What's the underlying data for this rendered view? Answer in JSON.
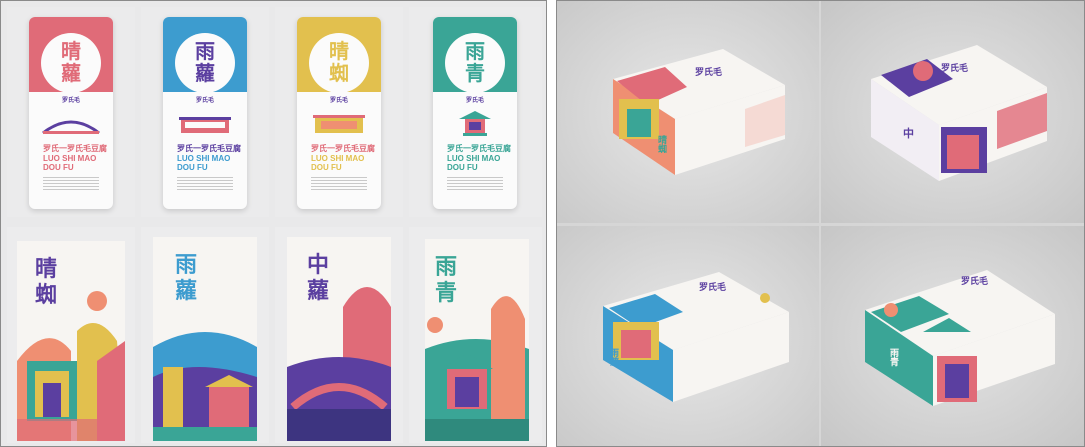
{
  "colors": {
    "pink": "#e06b78",
    "blue": "#3d9ccf",
    "yellow": "#e2c04e",
    "teal": "#3aa596",
    "purple": "#5b3fa0",
    "coral": "#ef8f72",
    "bg_left": "#e9e9ea",
    "bg_right": "#d6d6d6"
  },
  "pouches": [
    {
      "glyph_top": "晴",
      "glyph_bottom": "蘿",
      "brand": "罗氏毛",
      "cn_name": "罗氏一罗氏毛豆腐",
      "pinyin_1": "LUO SHI MAO",
      "pinyin_2": "DOU FU",
      "color": "#e06b78",
      "icon": "bridge-icon"
    },
    {
      "glyph_top": "雨",
      "glyph_bottom": "蘿",
      "brand": "罗氏毛",
      "cn_name": "罗氏一罗氏毛豆腐",
      "pinyin_1": "LUO SHI MAO",
      "pinyin_2": "DOU FU",
      "color": "#3d9ccf",
      "icon": "gate-icon"
    },
    {
      "glyph_top": "晴",
      "glyph_bottom": "蜘",
      "brand": "罗氏毛",
      "cn_name": "罗氏一罗氏毛豆腐",
      "pinyin_1": "LUO SHI MAO",
      "pinyin_2": "DOU FU",
      "color": "#e2c04e",
      "icon": "plaque-icon"
    },
    {
      "glyph_top": "雨",
      "glyph_bottom": "青",
      "brand": "罗氏毛",
      "cn_name": "罗氏一罗氏毛豆腐",
      "pinyin_1": "LUO SHI MAO",
      "pinyin_2": "DOU FU",
      "color": "#3aa596",
      "icon": "pavilion-icon"
    }
  ],
  "boxes_tall": [
    {
      "glyph_top": "晴",
      "glyph_bottom": "蜘"
    },
    {
      "glyph_top": "雨",
      "glyph_bottom": "蘿"
    },
    {
      "glyph_top": "中",
      "glyph_bottom": "蘿"
    },
    {
      "glyph_top": "雨",
      "glyph_bottom": "青"
    }
  ],
  "boxes_flat": [
    {
      "brand": "罗氏毛",
      "side_glyph": "晴蜘"
    },
    {
      "brand": "罗氏毛",
      "side_glyph": "中"
    },
    {
      "brand": "罗氏毛",
      "side_glyph": "雨蘿"
    },
    {
      "brand": "罗氏毛",
      "side_glyph": "雨青"
    }
  ]
}
